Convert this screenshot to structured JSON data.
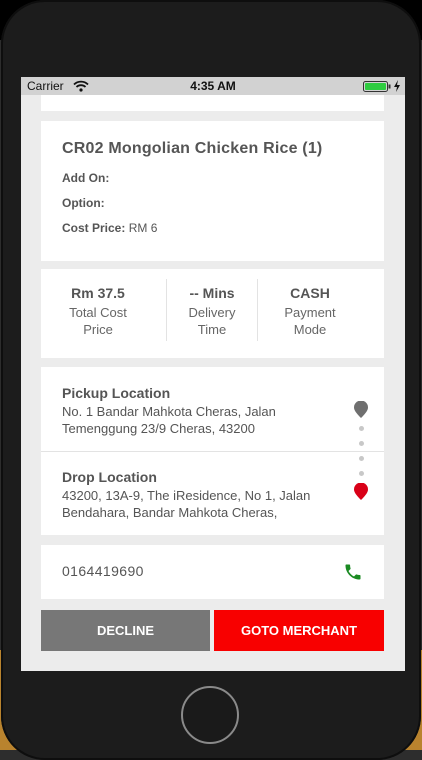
{
  "status_bar": {
    "carrier": "Carrier",
    "time": "4:35 AM",
    "battery_color": "#2ecc40"
  },
  "order_item": {
    "title": "CR02 Mongolian Chicken Rice (1)",
    "add_on_label": "Add On:",
    "add_on_value": "",
    "option_label": "Option:",
    "option_value": "",
    "cost_price_label": "Cost Price:",
    "cost_price_value": "RM 6"
  },
  "summary": {
    "total_cost": {
      "value": "Rm 37.5",
      "label_line1": "Total Cost",
      "label_line2": "Price"
    },
    "delivery_time": {
      "value": "-- Mins",
      "label_line1": "Delivery",
      "label_line2": "Time"
    },
    "payment_mode": {
      "value": "CASH",
      "label_line1": "Payment",
      "label_line2": "Mode"
    }
  },
  "locations": {
    "pickup": {
      "title": "Pickup Location",
      "address_line1": "No. 1 Bandar Mahkota Cheras, Jalan",
      "address_line2": "Temenggung 23/9 Cheras, 43200",
      "pin_color": "#6f6f6f"
    },
    "drop": {
      "title": "Drop Location",
      "address_line1": "43200, 13A-9, The iResidence, No 1, Jalan",
      "address_line2": "Bendahara, Bandar Mahkota Cheras,",
      "pin_color": "#d90018"
    }
  },
  "contact": {
    "phone_number": "0164419690",
    "call_icon_color": "#1a8a22"
  },
  "actions": {
    "decline_label": "DECLINE",
    "goto_label": "GOTO MERCHANT"
  },
  "icons": {
    "wifi": "wifi-icon",
    "battery": "battery-icon",
    "charge": "charging-bolt-icon",
    "pickup_pin": "pickup-pin-icon",
    "drop_pin": "drop-pin-icon",
    "call": "phone-call-icon"
  }
}
